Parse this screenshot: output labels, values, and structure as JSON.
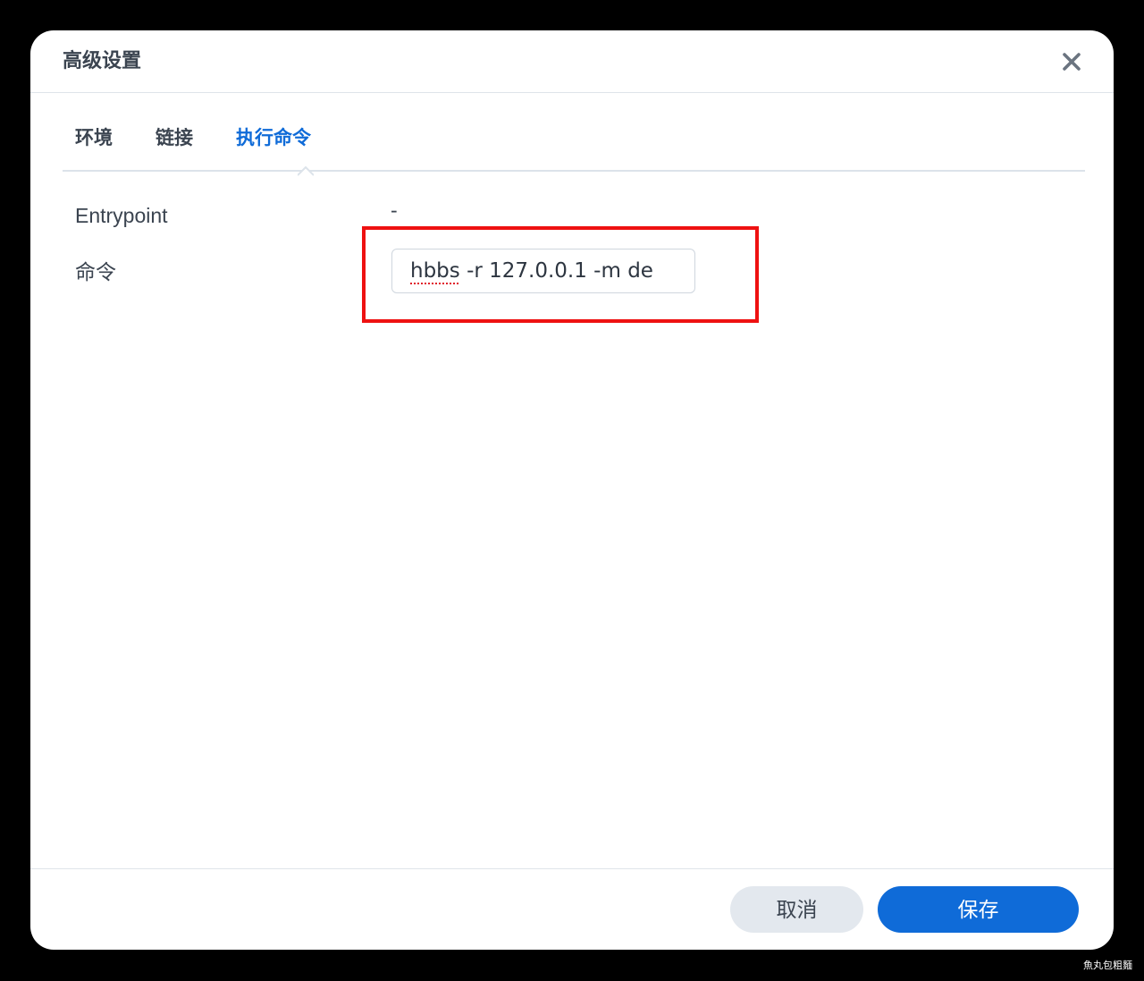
{
  "dialog": {
    "title": "高级设置",
    "close_icon": "close-icon"
  },
  "tabs": [
    {
      "label": "环境",
      "active": false
    },
    {
      "label": "链接",
      "active": false
    },
    {
      "label": "执行命令",
      "active": true
    }
  ],
  "fields": {
    "entrypoint": {
      "label": "Entrypoint",
      "value": "-"
    },
    "command": {
      "label": "命令",
      "value": "hbbs -r 127.0.0.1 -m de",
      "value_parts": {
        "misspelled": "hbbs",
        "rest": " -r 127.0.0.1 -m de"
      }
    }
  },
  "footer": {
    "cancel_label": "取消",
    "save_label": "保存"
  },
  "watermark": "魚丸包粗麵",
  "colors": {
    "accent": "#0f6bd8",
    "highlight": "#ee1111",
    "cancel_bg": "#e3e8ee",
    "text": "#3b4450"
  }
}
